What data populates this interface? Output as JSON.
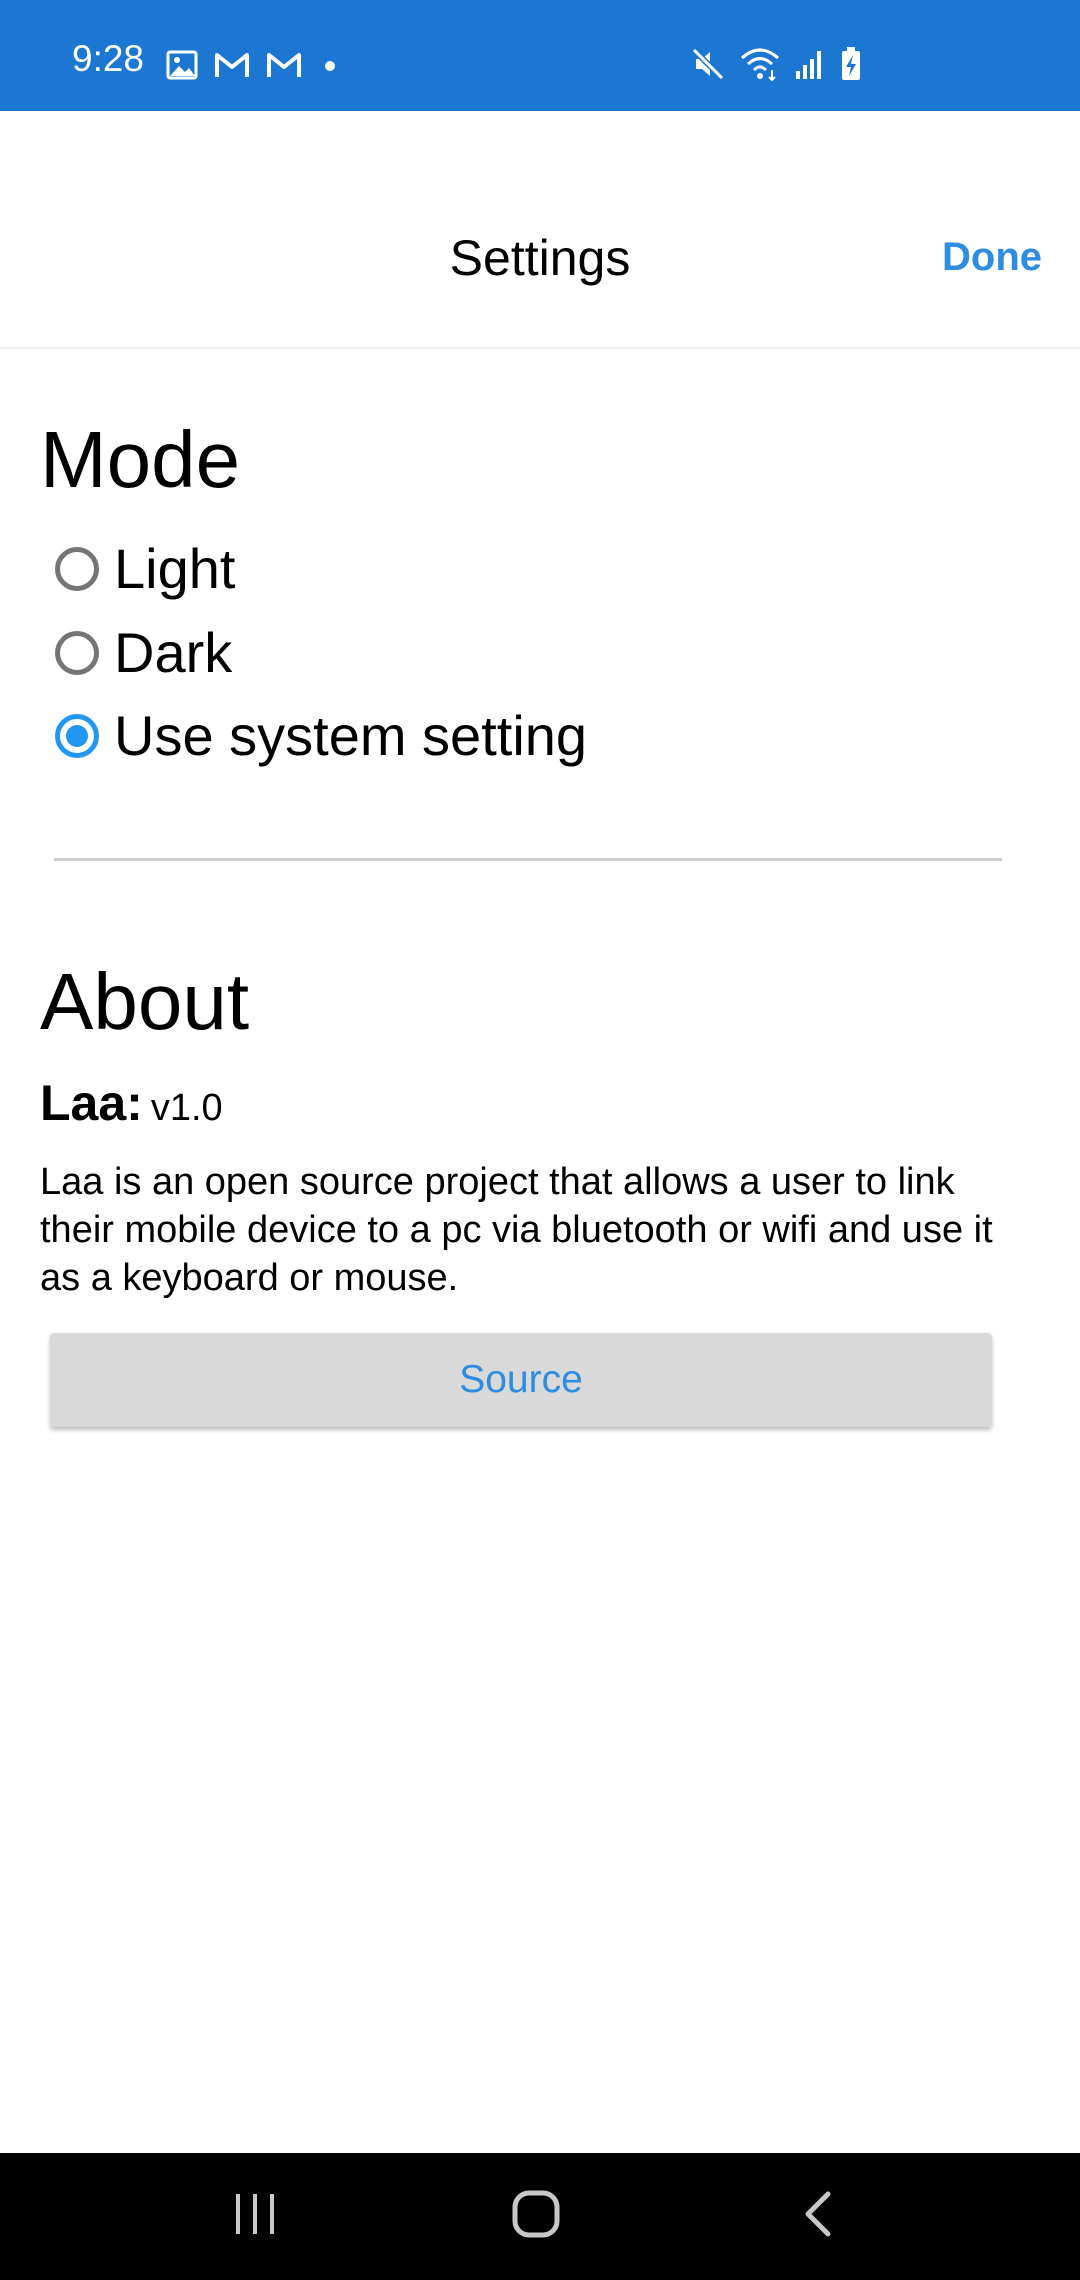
{
  "status_bar": {
    "time": "9:28",
    "left_icons": [
      "image-icon",
      "gmail-icon",
      "gmail-icon",
      "dot-icon"
    ],
    "right_icons": [
      "mute-icon",
      "wifi-icon",
      "signal-icon",
      "battery-charging-icon"
    ],
    "background_color": "#1c77d2"
  },
  "header": {
    "title": "Settings",
    "done_label": "Done"
  },
  "mode": {
    "heading": "Mode",
    "options": [
      {
        "label": "Light",
        "checked": false
      },
      {
        "label": "Dark",
        "checked": false
      },
      {
        "label": "Use system setting",
        "checked": true
      }
    ]
  },
  "about": {
    "heading": "About",
    "app_name": "Laa:",
    "version": "v1.0",
    "description": "Laa is an open source project that allows a user to link their mobile device to a pc via bluetooth or wifi and use it as a keyboard or mouse.",
    "source_label": "Source"
  },
  "nav_bar": {
    "icons": [
      "recent-apps-icon",
      "home-icon",
      "back-icon"
    ]
  },
  "colors": {
    "accent": "#2d8de0",
    "radio_selected": "#2196f3"
  }
}
